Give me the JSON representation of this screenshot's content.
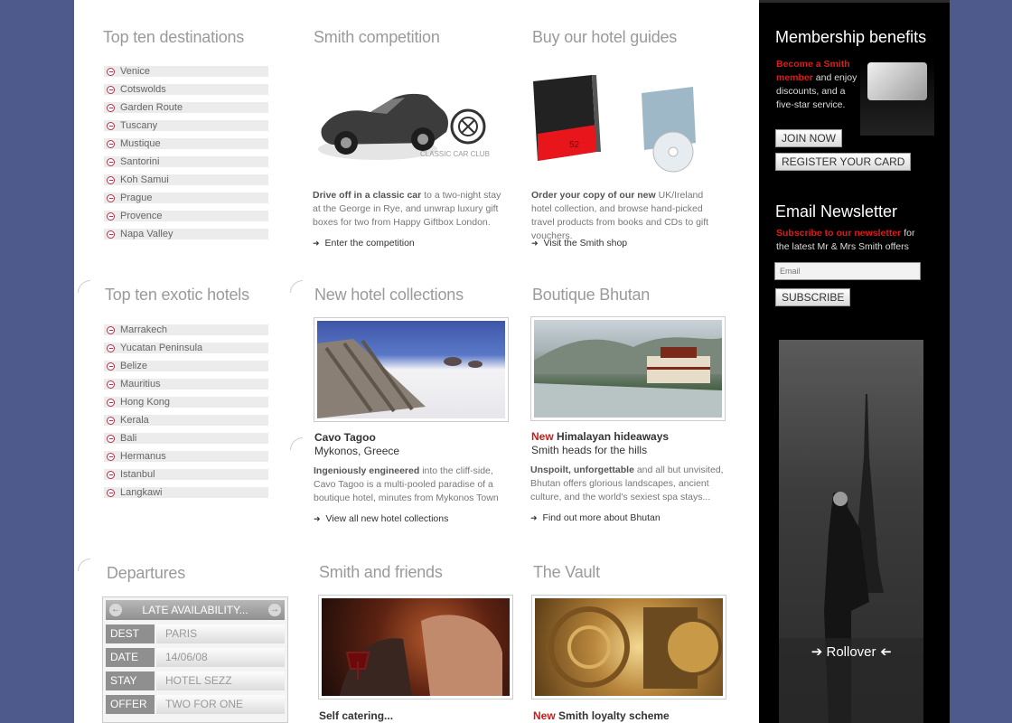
{
  "left_column": {
    "destinations": {
      "title": "Top ten destinations",
      "items": [
        "Venice",
        "Cotswolds",
        "Garden Route",
        "Tuscany",
        "Mustique",
        "Santorini",
        "Koh Samui",
        "Prague",
        "Provence",
        "Napa Valley"
      ]
    },
    "exotic": {
      "title": "Top ten exotic hotels",
      "items": [
        "Marrakech",
        "Yucatan Peninsula",
        "Belize",
        "Mauritius",
        "Hong Kong",
        "Kerala",
        "Bali",
        "Hermanus",
        "Istanbul",
        "Langkawi"
      ]
    },
    "departures": {
      "title": "Departures",
      "widget_title": "LATE AVAILABILITY...",
      "prev_icon": "←",
      "next_icon": "→",
      "rows": [
        {
          "label": "DEST",
          "value": "PARIS"
        },
        {
          "label": "DATE",
          "value": "14/06/08"
        },
        {
          "label": "STAY",
          "value": "HOTEL SEZZ"
        },
        {
          "label": "OFFER",
          "value": "TWO FOR ONE"
        }
      ]
    }
  },
  "competition": {
    "title": "Smith competition",
    "image_caption": "CLASSIC CAR CLUB",
    "text_bold": "Drive off in a classic car",
    "text": " to a two-night stay at the George in Rye, and unwrap luxury gift boxes for two from Happy Giftbox London.",
    "link": "Enter the competition"
  },
  "guides": {
    "title": "Buy our hotel guides",
    "book_number": "52",
    "text_bold": "Order your copy of our new",
    "text": " UK/Ireland hotel collection, and browse hand-picked travel products from books and CDs to gift vouchers.",
    "link": "Visit the Smith shop"
  },
  "collections": {
    "title": "New hotel collections",
    "caption_title": "Cavo Tagoo",
    "caption_sub": "Mykonos, Greece",
    "text_bold": "Ingeniously engineered",
    "text": " into the cliff-side, Cavo Tagoo is a multi-pooled paradise of a boutique hotel, minutes from Mykonos Town",
    "link": "View all new hotel collections"
  },
  "bhutan": {
    "title": "Boutique Bhutan",
    "caption_new": "New",
    "caption_title": " Himalayan hideaways",
    "caption_sub": "Smith heads for the hills",
    "text_bold": "Unspoilt, unforgettable",
    "text": " and all but unvisited, Bhutan offers glorious landscapes, ancient culture, and the world's sexiest spa stays...",
    "link": "Find out more about Bhutan"
  },
  "friends": {
    "title": "Smith and friends",
    "caption_title": "Self catering..."
  },
  "vault": {
    "title": "The Vault",
    "caption_new": "New",
    "caption_title": " Smith loyalty scheme"
  },
  "sidebar": {
    "membership_title": "Membership benefits",
    "membership_red": "Become a Smith member",
    "membership_text": " and enjoy discounts, and  a five-star service.",
    "join_button": "JOIN NOW",
    "register_button": "REGISTER YOUR CARD",
    "newsletter_title": "Email Newsletter",
    "newsletter_red": "Subscribe to our newsletter",
    "newsletter_text": " for the latest Mr & Mrs Smith offers",
    "email_placeholder": "Email",
    "subscribe_button": "SUBSCRIBE",
    "rollover_label": "Rollover"
  },
  "colors": {
    "page_background": "#4e5a8c",
    "accent_red": "#cc1b1b",
    "sidebar_background": "#000000"
  }
}
